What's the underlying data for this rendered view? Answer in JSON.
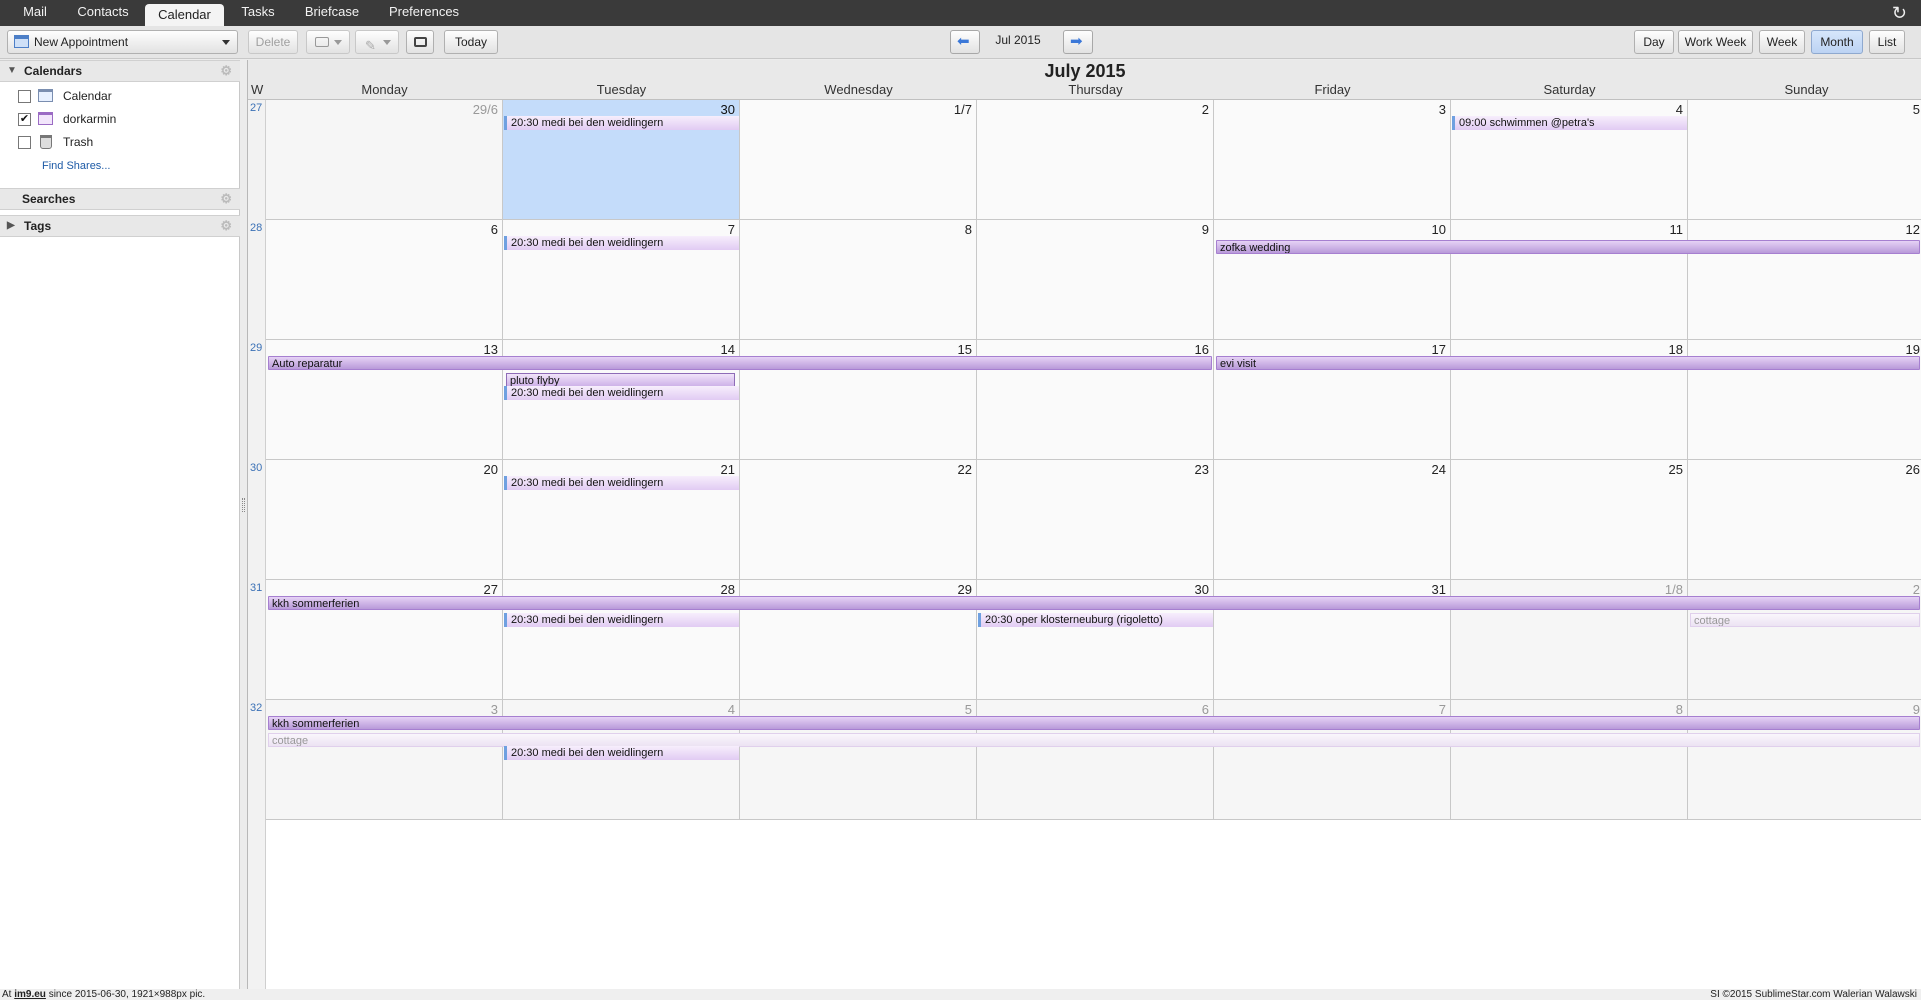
{
  "app_tabs": [
    "Mail",
    "Contacts",
    "Calendar",
    "Tasks",
    "Briefcase",
    "Preferences"
  ],
  "active_tab": "Calendar",
  "refresh_icon": "refresh-icon",
  "toolbar": {
    "new_appointment": "New Appointment",
    "delete": "Delete",
    "today": "Today",
    "range_label": "Jul 2015",
    "views": [
      "Day",
      "Work Week",
      "Week",
      "Month",
      "List"
    ],
    "active_view": "Month"
  },
  "sidebar": {
    "calendars_header": "Calendars",
    "calendars": [
      {
        "label": "Calendar",
        "checked": false,
        "icon": "calendar-icon"
      },
      {
        "label": "dorkarmin",
        "checked": true,
        "icon": "calendar-icon"
      },
      {
        "label": "Trash",
        "checked": false,
        "icon": "trash-icon"
      }
    ],
    "find_shares": "Find Shares...",
    "searches_header": "Searches",
    "tags_header": "Tags"
  },
  "calendar": {
    "title": "July 2015",
    "week_header": "W",
    "days_of_week": [
      "Monday",
      "Tuesday",
      "Wednesday",
      "Thursday",
      "Friday",
      "Saturday",
      "Sunday"
    ],
    "weeks": [
      {
        "num": "27",
        "days": [
          "29/6",
          "30",
          "1/7",
          "2",
          "3",
          "4",
          "5"
        ],
        "dim": [
          true,
          false,
          false,
          false,
          false,
          false,
          false
        ]
      },
      {
        "num": "28",
        "days": [
          "6",
          "7",
          "8",
          "9",
          "10",
          "11",
          "12"
        ],
        "dim": [
          false,
          false,
          false,
          false,
          false,
          false,
          false
        ]
      },
      {
        "num": "29",
        "days": [
          "13",
          "14",
          "15",
          "16",
          "17",
          "18",
          "19"
        ],
        "dim": [
          false,
          false,
          false,
          false,
          false,
          false,
          false
        ]
      },
      {
        "num": "30",
        "days": [
          "20",
          "21",
          "22",
          "23",
          "24",
          "25",
          "26"
        ],
        "dim": [
          false,
          false,
          false,
          false,
          false,
          false,
          false
        ]
      },
      {
        "num": "31",
        "days": [
          "27",
          "28",
          "29",
          "30",
          "31",
          "1/8",
          "2"
        ],
        "dim": [
          false,
          false,
          false,
          false,
          false,
          true,
          true
        ]
      },
      {
        "num": "32",
        "days": [
          "3",
          "4",
          "5",
          "6",
          "7",
          "8",
          "9"
        ],
        "dim": [
          true,
          true,
          true,
          true,
          true,
          true,
          true
        ]
      }
    ],
    "today": {
      "week": 0,
      "day": 1
    },
    "events": [
      {
        "week": 0,
        "start": 1,
        "span": 1,
        "slot": 0,
        "kind": "timed",
        "label": "20:30 medi bei den weidlingern"
      },
      {
        "week": 0,
        "start": 5,
        "span": 1,
        "slot": 0,
        "kind": "timed",
        "label": "09:00 schwimmen @petra's"
      },
      {
        "week": 1,
        "start": 1,
        "span": 1,
        "slot": 0,
        "kind": "timed",
        "label": "20:30 medi bei den weidlingern"
      },
      {
        "week": 1,
        "start": 4,
        "span": 3,
        "slot": 0,
        "kind": "allday",
        "label": "zofka wedding"
      },
      {
        "week": 2,
        "start": 0,
        "span": 4,
        "slot": 0,
        "kind": "allday",
        "label": "Auto reparatur"
      },
      {
        "week": 2,
        "start": 4,
        "span": 3,
        "slot": 0,
        "kind": "allday",
        "label": "evi visit"
      },
      {
        "week": 2,
        "start": 1,
        "span": 1,
        "slot": 1,
        "kind": "boxed",
        "label": "pluto flyby"
      },
      {
        "week": 2,
        "start": 1,
        "span": 1,
        "slot": 2,
        "kind": "timed",
        "label": "20:30 medi bei den weidlingern"
      },
      {
        "week": 3,
        "start": 1,
        "span": 1,
        "slot": 0,
        "kind": "timed",
        "label": "20:30 medi bei den weidlingern"
      },
      {
        "week": 4,
        "start": 0,
        "span": 7,
        "slot": 0,
        "kind": "allday",
        "label": "kkh sommerferien"
      },
      {
        "week": 4,
        "start": 1,
        "span": 1,
        "slot": 1,
        "kind": "timed",
        "label": "20:30 medi bei den weidlingern"
      },
      {
        "week": 4,
        "start": 3,
        "span": 1,
        "slot": 1,
        "kind": "timed",
        "label": "20:30 oper klosterneuburg (rigoletto)"
      },
      {
        "week": 4,
        "start": 6,
        "span": 1,
        "slot": 1,
        "kind": "faint",
        "label": "cottage"
      },
      {
        "week": 5,
        "start": 0,
        "span": 7,
        "slot": 0,
        "kind": "allday",
        "label": "kkh sommerferien"
      },
      {
        "week": 5,
        "start": 0,
        "span": 7,
        "slot": 1,
        "kind": "faint",
        "label": "cottage"
      },
      {
        "week": 5,
        "start": 1,
        "span": 1,
        "slot": 2,
        "kind": "timed",
        "label": "20:30 medi bei den weidlingern"
      }
    ]
  },
  "footer": {
    "left_prefix": "At",
    "left_link": "im9.eu",
    "left_suffix": "since 2015-06-30, 1921×988px pic.",
    "right": "SI ©2015 SublimeStar.com Walerian Walawski"
  },
  "colors": {
    "allday_event": "#b89ad9",
    "timed_event": "#e1cbf3",
    "today_cell": "#c4dcfa",
    "week_number": "#3b71b6"
  }
}
